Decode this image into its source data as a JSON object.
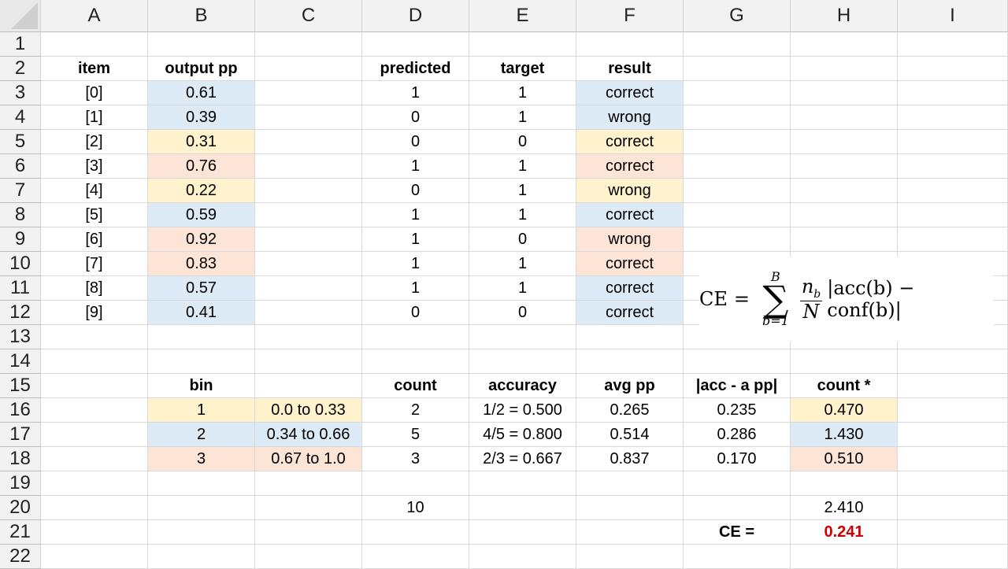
{
  "columns": [
    "A",
    "B",
    "C",
    "D",
    "E",
    "F",
    "G",
    "H",
    "I"
  ],
  "rows": [
    "1",
    "2",
    "3",
    "4",
    "5",
    "6",
    "7",
    "8",
    "9",
    "10",
    "11",
    "12",
    "13",
    "14",
    "15",
    "16",
    "17",
    "18",
    "19",
    "20",
    "21",
    "22"
  ],
  "headers1": {
    "item": "item",
    "output": "output pp",
    "predicted": "predicted",
    "target": "target",
    "result": "result"
  },
  "items": [
    {
      "item": "[0]",
      "pp": "0.61",
      "pred": "1",
      "target": "1",
      "result": "correct"
    },
    {
      "item": "[1]",
      "pp": "0.39",
      "pred": "0",
      "target": "1",
      "result": "wrong"
    },
    {
      "item": "[2]",
      "pp": "0.31",
      "pred": "0",
      "target": "0",
      "result": "correct"
    },
    {
      "item": "[3]",
      "pp": "0.76",
      "pred": "1",
      "target": "1",
      "result": "correct"
    },
    {
      "item": "[4]",
      "pp": "0.22",
      "pred": "0",
      "target": "1",
      "result": "wrong"
    },
    {
      "item": "[5]",
      "pp": "0.59",
      "pred": "1",
      "target": "1",
      "result": "correct"
    },
    {
      "item": "[6]",
      "pp": "0.92",
      "pred": "1",
      "target": "0",
      "result": "wrong"
    },
    {
      "item": "[7]",
      "pp": "0.83",
      "pred": "1",
      "target": "1",
      "result": "correct"
    },
    {
      "item": "[8]",
      "pp": "0.57",
      "pred": "1",
      "target": "1",
      "result": "correct"
    },
    {
      "item": "[9]",
      "pp": "0.41",
      "pred": "0",
      "target": "0",
      "result": "correct"
    }
  ],
  "headers2": {
    "bin": "bin",
    "count": "count",
    "accuracy": "accuracy",
    "avgpp": "avg pp",
    "diff": "|acc - a pp|",
    "countx": "count *"
  },
  "bins": [
    {
      "bin": "1",
      "range": "0.0 to 0.33",
      "count": "2",
      "acc": "1/2 = 0.500",
      "avg": "0.265",
      "diff": "0.235",
      "prod": "0.470"
    },
    {
      "bin": "2",
      "range": "0.34 to 0.66",
      "count": "5",
      "acc": "4/5 = 0.800",
      "avg": "0.514",
      "diff": "0.286",
      "prod": "1.430"
    },
    {
      "bin": "3",
      "range": "0.67 to 1.0",
      "count": "3",
      "acc": "2/3 = 0.667",
      "avg": "0.837",
      "diff": "0.170",
      "prod": "0.510"
    }
  ],
  "totals": {
    "count": "10",
    "sum": "2.410",
    "ce_label": "CE =",
    "ce_value": "0.241"
  },
  "formula": {
    "lhs": "CE",
    "eq": "=",
    "upper": "B",
    "lower": "b=1",
    "num": "n",
    "num_sub": "b",
    "den": "N",
    "body": "|acc(b) − conf(b)|"
  },
  "colors": {
    "blue": "#ddebf7",
    "yellow": "#fff2cc",
    "red": "#fce4d6",
    "ce_value": "#d00000"
  },
  "item_colors": [
    "blue",
    "blue",
    "yellow",
    "red",
    "yellow",
    "blue",
    "red",
    "red",
    "blue",
    "blue"
  ],
  "bin_colors": [
    "yellow",
    "blue",
    "red"
  ]
}
